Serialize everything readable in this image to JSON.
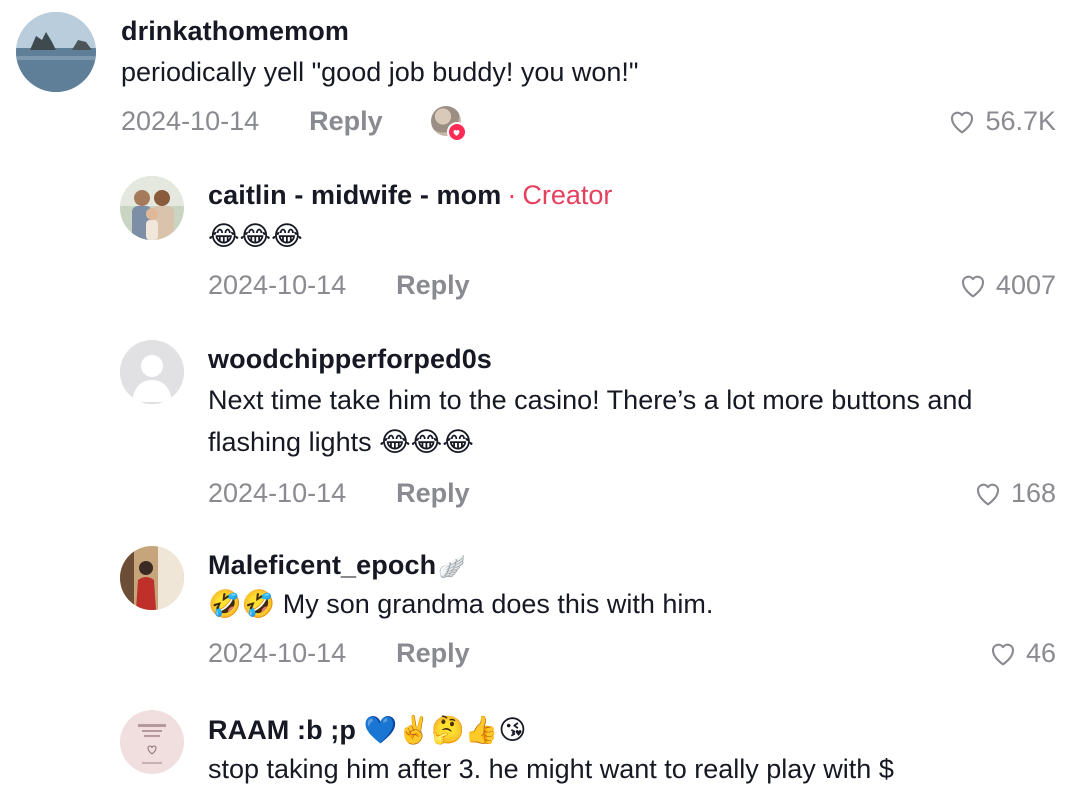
{
  "comments": [
    {
      "username": "drinkathomemom",
      "text": "periodically yell \"good job buddy! you won!\"",
      "date": "2024-10-14",
      "reply_label": "Reply",
      "likes": "56.7K",
      "liked_by_creator": true
    },
    {
      "username": "caitlin - midwife - mom",
      "creator_sep": "·",
      "creator_label": "Creator",
      "text": "😂😂😂",
      "date": "2024-10-14",
      "reply_label": "Reply",
      "likes": "4007"
    },
    {
      "username": "woodchipperforped0s",
      "text": "Next time take him to the casino! There’s a lot more buttons and flashing lights 😂😂😂",
      "date": "2024-10-14",
      "reply_label": "Reply",
      "likes": "168"
    },
    {
      "username": "Maleficent_epoch",
      "username_suffix": "🪽",
      "text": "🤣🤣 My son grandma does this with him.",
      "date": "2024-10-14",
      "reply_label": "Reply",
      "likes": "46"
    },
    {
      "username": "RAAM :b ;p 💙✌️🤔👍😘",
      "text": "stop taking him after 3. he might want to really play with $"
    }
  ],
  "colors": {
    "creator_accent": "#e5405e",
    "muted": "#8a8b91",
    "text": "#161823"
  },
  "icons": [
    "heart-outline-icon",
    "default-avatar-icon",
    "liked-by-creator-heart-icon"
  ]
}
